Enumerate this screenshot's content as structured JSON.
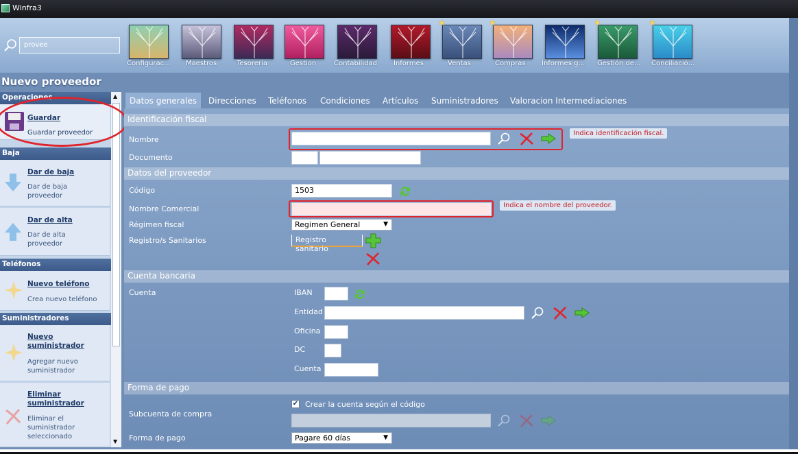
{
  "titlebar": {
    "title": "Winfra3"
  },
  "search": {
    "value": "provee",
    "icon": "search-icon"
  },
  "apps": [
    {
      "label": "Configurac...",
      "colors": [
        "#8fd0b0",
        "#d7b46a"
      ],
      "star": false
    },
    {
      "label": "Maestros",
      "colors": [
        "#c7c3dc",
        "#5b5b7a"
      ],
      "star": false
    },
    {
      "label": "Tesorería",
      "colors": [
        "#b02a62",
        "#3c2a55"
      ],
      "star": false
    },
    {
      "label": "Gestion",
      "colors": [
        "#f05b9e",
        "#b0205f"
      ],
      "star": false
    },
    {
      "label": "Contabilidad",
      "colors": [
        "#5c2a6a",
        "#2a1a3a"
      ],
      "star": false
    },
    {
      "label": "Informes",
      "colors": [
        "#b21a2a",
        "#5a0d15"
      ],
      "star": false
    },
    {
      "label": "Ventas",
      "colors": [
        "#6a88b8",
        "#3a507a"
      ],
      "star": true
    },
    {
      "label": "Compras",
      "colors": [
        "#f3b07a",
        "#a98ac0"
      ],
      "star": true
    },
    {
      "label": "Informes g...",
      "colors": [
        "#0d2a6a",
        "#5a90e0"
      ],
      "star": false
    },
    {
      "label": "Gestión de...",
      "colors": [
        "#3a9a6a",
        "#1a5a3a"
      ],
      "star": true
    },
    {
      "label": "Conciliació...",
      "colors": [
        "#4ad0e8",
        "#2a8ac8"
      ],
      "star": true
    }
  ],
  "page": {
    "title": "Nuevo proveedor"
  },
  "sidebar": {
    "sections": {
      "operaciones": "Operaciones",
      "baja": "Baja",
      "telefonos": "Teléfonos",
      "suministradores": "Suministradores"
    },
    "actions": {
      "guardar": {
        "title": "Guardar",
        "desc": "Guardar proveedor"
      },
      "dar_baja": {
        "title": "Dar de baja",
        "desc1": "Dar de baja",
        "desc2": "proveedor"
      },
      "dar_alta": {
        "title": "Dar de alta",
        "desc1": "Dar de alta",
        "desc2": "proveedor"
      },
      "nuevo_telefono": {
        "title": "Nuevo teléfono",
        "desc": "Crea nuevo teléfono"
      },
      "nuevo_sumin": {
        "title1": "Nuevo",
        "title2": "suministrador",
        "desc1": "Agregar nuevo",
        "desc2": "suministrador"
      },
      "eliminar_sumin": {
        "title1": "Eliminar",
        "title2": "suministrador",
        "desc1": "Eliminar el",
        "desc2": "suministrador",
        "desc3": "seleccionado"
      }
    }
  },
  "tabs": [
    "Datos generales",
    "Direcciones",
    "Teléfonos",
    "Condiciones",
    "Artículos",
    "Suministradores",
    "Valoracion Intermediaciones"
  ],
  "form": {
    "sections": {
      "fiscal": "Identificación fiscal",
      "proveedor": "Datos del proveedor",
      "banco": "Cuenta bancaria",
      "pago": "Forma de pago"
    },
    "labels": {
      "nombre": "Nombre",
      "documento": "Documento",
      "codigo": "Código",
      "nombre_comercial": "Nombre Comercial",
      "regimen": "Régimen fiscal",
      "registros": "Registro/s Sanitarios",
      "cuenta": "Cuenta",
      "iban": "IBAN",
      "entidad": "Entidad",
      "oficina": "Oficina",
      "dc": "DC",
      "cuenta_num": "Cuenta",
      "subcuenta": "Subcuenta de compra",
      "forma_pago": "Forma de pago",
      "crear_cuenta": "Crear la cuenta según el código"
    },
    "values": {
      "codigo": "1503",
      "regimen": "Regimen General",
      "registro_btn": "Registro sanitario",
      "forma_pago": "Pagare 60 días",
      "crear_cuenta_checked": true
    },
    "tips": {
      "fiscal": "Indica identificación fiscal.",
      "nombre": "Indica el nombre del proveedor."
    }
  },
  "colors": {
    "accent_red": "#e0242c",
    "section_bar": "#3c5b8a",
    "tip_text": "#c4161c"
  }
}
